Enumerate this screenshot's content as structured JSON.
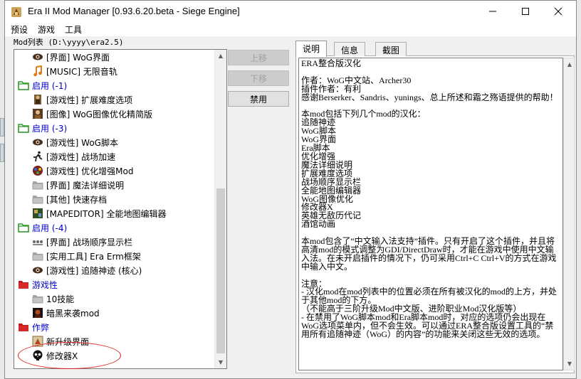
{
  "window": {
    "title": "Era II Mod Manager [0.93.6.20.beta - Siege Engine]",
    "controls": {
      "minimize": "—",
      "maximize": "☐",
      "close": "✕"
    }
  },
  "menu": [
    "预设",
    "游戏",
    "工具"
  ],
  "mod_list_label": "Mod列表 (D:\\yyyy\\era2.5)",
  "tree": [
    {
      "kind": "item",
      "label": "[界面] WoG界面",
      "icon": "eye-icon"
    },
    {
      "kind": "item",
      "label": "[MUSIC] 无限音轨",
      "icon": "music-icon"
    },
    {
      "kind": "group",
      "label": "启用 (-1)",
      "icon": "folder-green-icon"
    },
    {
      "kind": "item",
      "label": "[游戏性] 扩展难度选项",
      "icon": "unit-icon"
    },
    {
      "kind": "item",
      "label": "[图像] WoG图像优化精简版",
      "icon": "portrait-icon"
    },
    {
      "kind": "group",
      "label": "启用 (-3)",
      "icon": "folder-green-icon"
    },
    {
      "kind": "item",
      "label": "[游戏性] WoG脚本",
      "icon": "eye-icon"
    },
    {
      "kind": "item",
      "label": "[游戏性] 战场加速",
      "icon": "runner-icon"
    },
    {
      "kind": "item",
      "label": "[游戏性] 优化增强Mod",
      "icon": "gem-icon"
    },
    {
      "kind": "item",
      "label": "[界面] 魔法详细说明",
      "icon": "folder-gray-icon"
    },
    {
      "kind": "item",
      "label": "[其他] 快速存档",
      "icon": "folder-gray-icon"
    },
    {
      "kind": "item",
      "label": "[MAPEDITOR] 全能地图编辑器",
      "icon": "map-icon"
    },
    {
      "kind": "group",
      "label": "启用 (-4)",
      "icon": "folder-green-icon"
    },
    {
      "kind": "item",
      "label": "[界面] 战场顺序显示栏",
      "icon": "units-row-icon"
    },
    {
      "kind": "item",
      "label": "[实用工具] Era Erm框架",
      "icon": "folder-gray-icon"
    },
    {
      "kind": "item",
      "label": "[游戏性] 追随神迹 (核心)",
      "icon": "eye-icon"
    },
    {
      "kind": "group",
      "label": "游戏性",
      "icon": "folder-red-icon"
    },
    {
      "kind": "item",
      "label": "10技能",
      "icon": "folder-gray-icon"
    },
    {
      "kind": "item",
      "label": "暗黑来袭mod",
      "icon": "dark-portrait-icon"
    },
    {
      "kind": "group",
      "label": "作弊",
      "icon": "folder-red-icon"
    },
    {
      "kind": "item",
      "label": "新升级界面",
      "icon": "upgrade-icon"
    },
    {
      "kind": "item",
      "label": "修改器X",
      "icon": "skull-icon"
    }
  ],
  "buttons": {
    "move_up": "上移",
    "move_down": "下移",
    "disable": "禁用"
  },
  "tabs": [
    "说明",
    "信息",
    "截图"
  ],
  "description": [
    "ERA整合版汉化",
    "",
    "作者：WoG中文站、Archer30",
    "插件作者：有利",
    "感谢Berserker、Sandris、yunings、总上所述和霜之殇语提供的帮助！",
    "",
    "本mod包括下列几个mod的汉化：",
    "追随神迹",
    "WoG脚本",
    "WoG界面",
    "Era脚本",
    "优化增强",
    "魔法详细说明",
    "扩展难度选项",
    "战场顺序显示栏",
    "全能地图编辑器",
    "WoG图像优化",
    "修改器X",
    "英雄无敌历代记",
    "酒馆动画",
    "",
    "本mod包含了“中文输入法支持”插件。只有开启了这个插件，并且将高清mod的模式调整为GDI/DirectDraw时，才能在游戏中使用中文输入法。在未开启插件的情况下，仍可采用Ctrl+C Ctrl+V的方式在游戏中输入中文。",
    "",
    "注意：",
    "- 汉化mod在mod列表中的位置必须在所有被汉化的mod的上方，并处于其他mod的下方。",
    "（不能高于三阶升级Mod中文版、进阶职业Mod汉化版等）",
    "- 在禁用了WoG脚本mod和Era脚本mod时，对应的选项仍会出现在WoG选项菜单内，但不会生效。可以通过ERA整合版设置工具的“禁用所有追随神迹（WoG）的内容”的功能来关闭这些无效的选项。"
  ],
  "annotation_color": "#e02020"
}
